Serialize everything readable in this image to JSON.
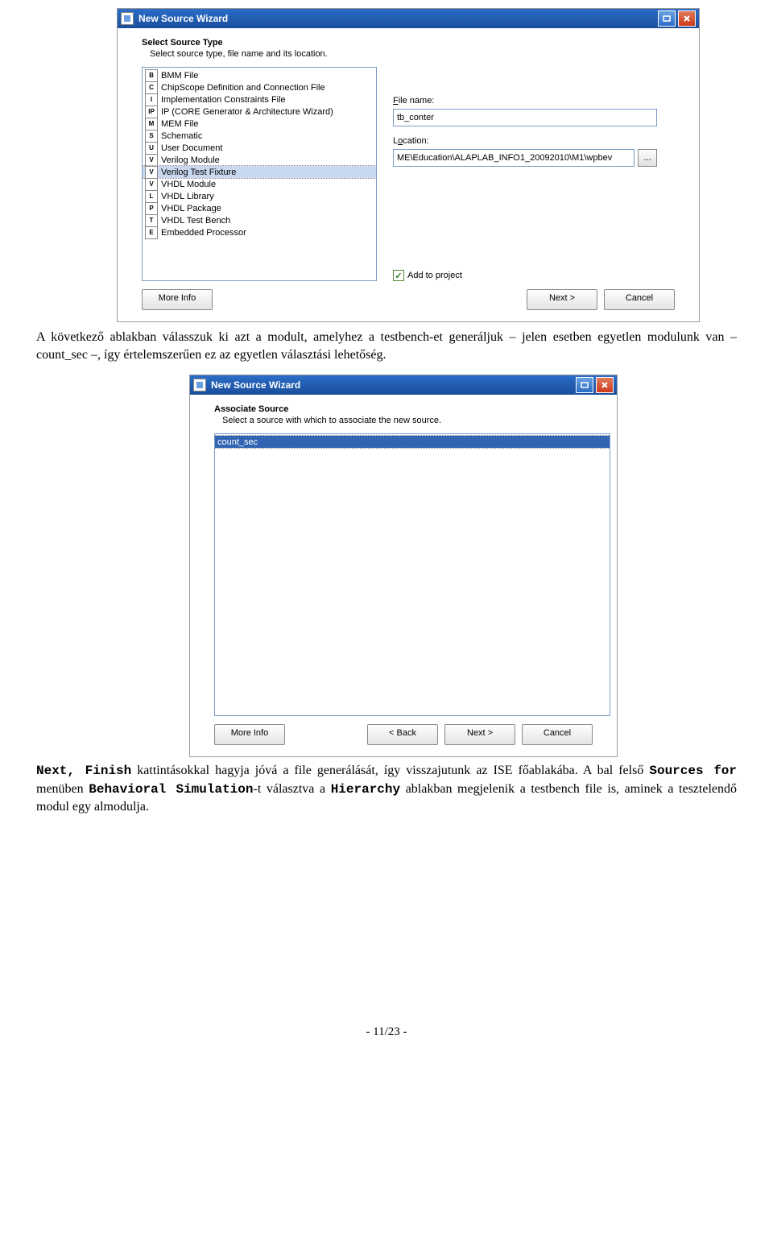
{
  "dialog1": {
    "title": "New Source Wizard",
    "section_title": "Select Source Type",
    "section_sub": "Select source type, file name and its location.",
    "items": [
      {
        "icon": "B",
        "label": "BMM File"
      },
      {
        "icon": "C",
        "label": "ChipScope Definition and Connection File"
      },
      {
        "icon": "I",
        "label": "Implementation Constraints File"
      },
      {
        "icon": "IP",
        "label": "IP (CORE Generator & Architecture Wizard)"
      },
      {
        "icon": "M",
        "label": "MEM File"
      },
      {
        "icon": "S",
        "label": "Schematic"
      },
      {
        "icon": "U",
        "label": "User Document"
      },
      {
        "icon": "V",
        "label": "Verilog Module"
      },
      {
        "icon": "V",
        "label": "Verilog Test Fixture",
        "selected": true
      },
      {
        "icon": "V",
        "label": "VHDL Module"
      },
      {
        "icon": "L",
        "label": "VHDL Library"
      },
      {
        "icon": "P",
        "label": "VHDL Package"
      },
      {
        "icon": "T",
        "label": "VHDL Test Bench"
      },
      {
        "icon": "E",
        "label": "Embedded Processor"
      }
    ],
    "filename_label": "File name:",
    "filename_value": "tb_conter",
    "location_label": "Location:",
    "location_value": "ME\\Education\\ALAPLAB_INFO1_20092010\\M1\\wpbev",
    "add_to_project": "Add to project",
    "more_info": "More Info",
    "next": "Next >",
    "cancel": "Cancel"
  },
  "para1": {
    "text_a": "A következő ablakban válasszuk ki azt a modult, amelyhez a testbench-et generáljuk – jelen esetben egyetlen modulunk van – count_sec –, így értelemszerűen ez az egyetlen választási lehetőség."
  },
  "dialog2": {
    "title": "New Source Wizard",
    "section_title": "Associate Source",
    "section_sub": "Select a source with which to associate the new source.",
    "item": "count_sec",
    "more_info": "More Info",
    "back": "< Back",
    "next": "Next >",
    "cancel": "Cancel"
  },
  "para2": {
    "pre": "",
    "mono1": "Next, Finish",
    "mid1": " kattintásokkal hagyja jóvá a file generálását, így visszajutunk az ISE főablakába. A bal felső ",
    "mono2": "Sources for",
    "mid2": " menüben ",
    "mono3": "Behavioral Simulation",
    "mid3": "-t választva a ",
    "mono4": "Hierarchy",
    "mid4": " ablakban megjelenik a testbench file is, aminek a tesztelendő modul egy almodulja."
  },
  "page_number": "- 11/23 -"
}
